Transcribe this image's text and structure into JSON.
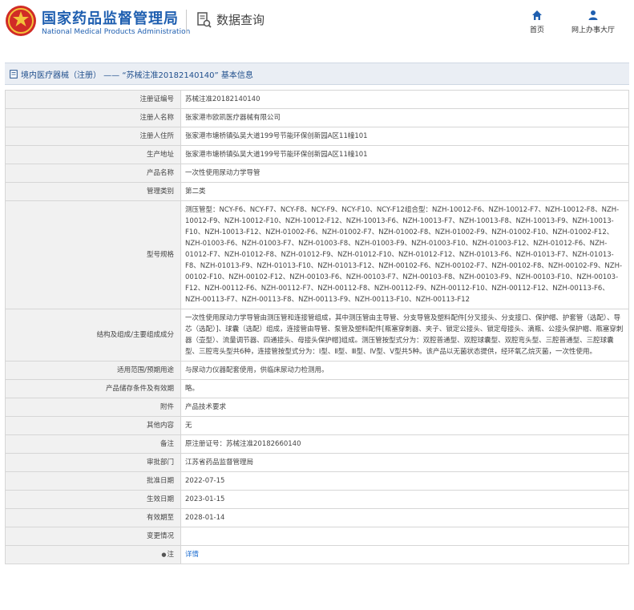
{
  "header": {
    "brand_cn": "国家药品监督管理局",
    "brand_en": "National Medical Products Administration",
    "query_title": "数据查询",
    "nav": [
      {
        "label": "首页",
        "icon": "home-icon"
      },
      {
        "label": "网上办事大厅",
        "icon": "user-icon"
      }
    ],
    "colors": {
      "brand": "#1f5fb0",
      "logo_red": "#d12b26"
    }
  },
  "breadcrumb": {
    "text": "境内医疗器械（注册） —— “苏械注准20182140140” 基本信息"
  },
  "rows": [
    {
      "label": "注册证编号",
      "value": "苏械注准20182140140"
    },
    {
      "label": "注册人名称",
      "value": "张家港市欧凯医疗器械有限公司"
    },
    {
      "label": "注册人住所",
      "value": "张家港市塘桥镇弘吴大道199号节能环保创新园A区11幢101"
    },
    {
      "label": "生产地址",
      "value": "张家港市塘桥镇弘吴大道199号节能环保创新园A区11幢101"
    },
    {
      "label": "产品名称",
      "value": "一次性使用尿动力学导管"
    },
    {
      "label": "管理类别",
      "value": "第二类"
    },
    {
      "label": "型号规格",
      "value": "测压管型：NCY-F6、NCY-F7、NCY-F8、NCY-F9、NCY-F10、NCY-F12组合型：NZH-10012-F6、NZH-10012-F7、NZH-10012-F8、NZH-10012-F9、NZH-10012-F10、NZH-10012-F12、NZH-10013-F6、NZH-10013-F7、NZH-10013-F8、NZH-10013-F9、NZH-10013-F10、NZH-10013-F12、NZH-01002-F6、NZH-01002-F7、NZH-01002-F8、NZH-01002-F9、NZH-01002-F10、NZH-01002-F12、NZH-01003-F6、NZH-01003-F7、NZH-01003-F8、NZH-01003-F9、NZH-01003-F10、NZH-01003-F12、NZH-01012-F6、NZH-01012-F7、NZH-01012-F8、NZH-01012-F9、NZH-01012-F10、NZH-01012-F12、NZH-01013-F6、NZH-01013-F7、NZH-01013-F8、NZH-01013-F9、NZH-01013-F10、NZH-01013-F12、NZH-00102-F6、NZH-00102-F7、NZH-00102-F8、NZH-00102-F9、NZH-00102-F10、NZH-00102-F12、NZH-00103-F6、NZH-00103-F7、NZH-00103-F8、NZH-00103-F9、NZH-00103-F10、NZH-00103-F12、NZH-00112-F6、NZH-00112-F7、NZH-00112-F8、NZH-00112-F9、NZH-00112-F10、NZH-00112-F12、NZH-00113-F6、NZH-00113-F7、NZH-00113-F8、NZH-00113-F9、NZH-00113-F10、NZH-00113-F12"
    },
    {
      "label": "结构及组成/主要组成成分",
      "value": "一次性使用尿动力学导管由测压管和连接管组成，其中测压管由主导管、分支导管及塑料配件[分叉接头、分支接口、保护帽、护套管（选配）、导芯（选配）]、球囊（选配）组成，连接管由导管、泵管及塑料配件[瓶塞穿刺器、夹子、锁定公接头、锁定母接头、滴瓶、公接头保护帽、瓶塞穿刺器（壶型）、流量调节器、四通接头、母接头保护帽]组成。测压管按型式分为：双腔普通型、双腔球囊型、双腔弯头型、三腔普通型、三腔球囊型、三腔弯头型共6种，连接管按型式分为：Ⅰ型、Ⅱ型、Ⅲ型、Ⅳ型、Ⅴ型共5种。该产品以无菌状态提供，经环氧乙烷灭菌，一次性使用。"
    },
    {
      "label": "适用范围/预期用途",
      "value": "与尿动力仪器配套使用，供临床尿动力检测用。"
    },
    {
      "label": "产品储存条件及有效期",
      "value": "略。"
    },
    {
      "label": "附件",
      "value": "产品技术要求"
    },
    {
      "label": "其他内容",
      "value": "无"
    },
    {
      "label": "备注",
      "value": "原注册证号：苏械注准20182660140"
    },
    {
      "label": "审批部门",
      "value": "江苏省药品监督管理局"
    },
    {
      "label": "批准日期",
      "value": "2022-07-15"
    },
    {
      "label": "生效日期",
      "value": "2023-01-15"
    },
    {
      "label": "有效期至",
      "value": "2028-01-14"
    },
    {
      "label": "变更情况",
      "value": ""
    },
    {
      "label": "注",
      "value": "详情",
      "label_icon": "bullet-icon"
    }
  ]
}
